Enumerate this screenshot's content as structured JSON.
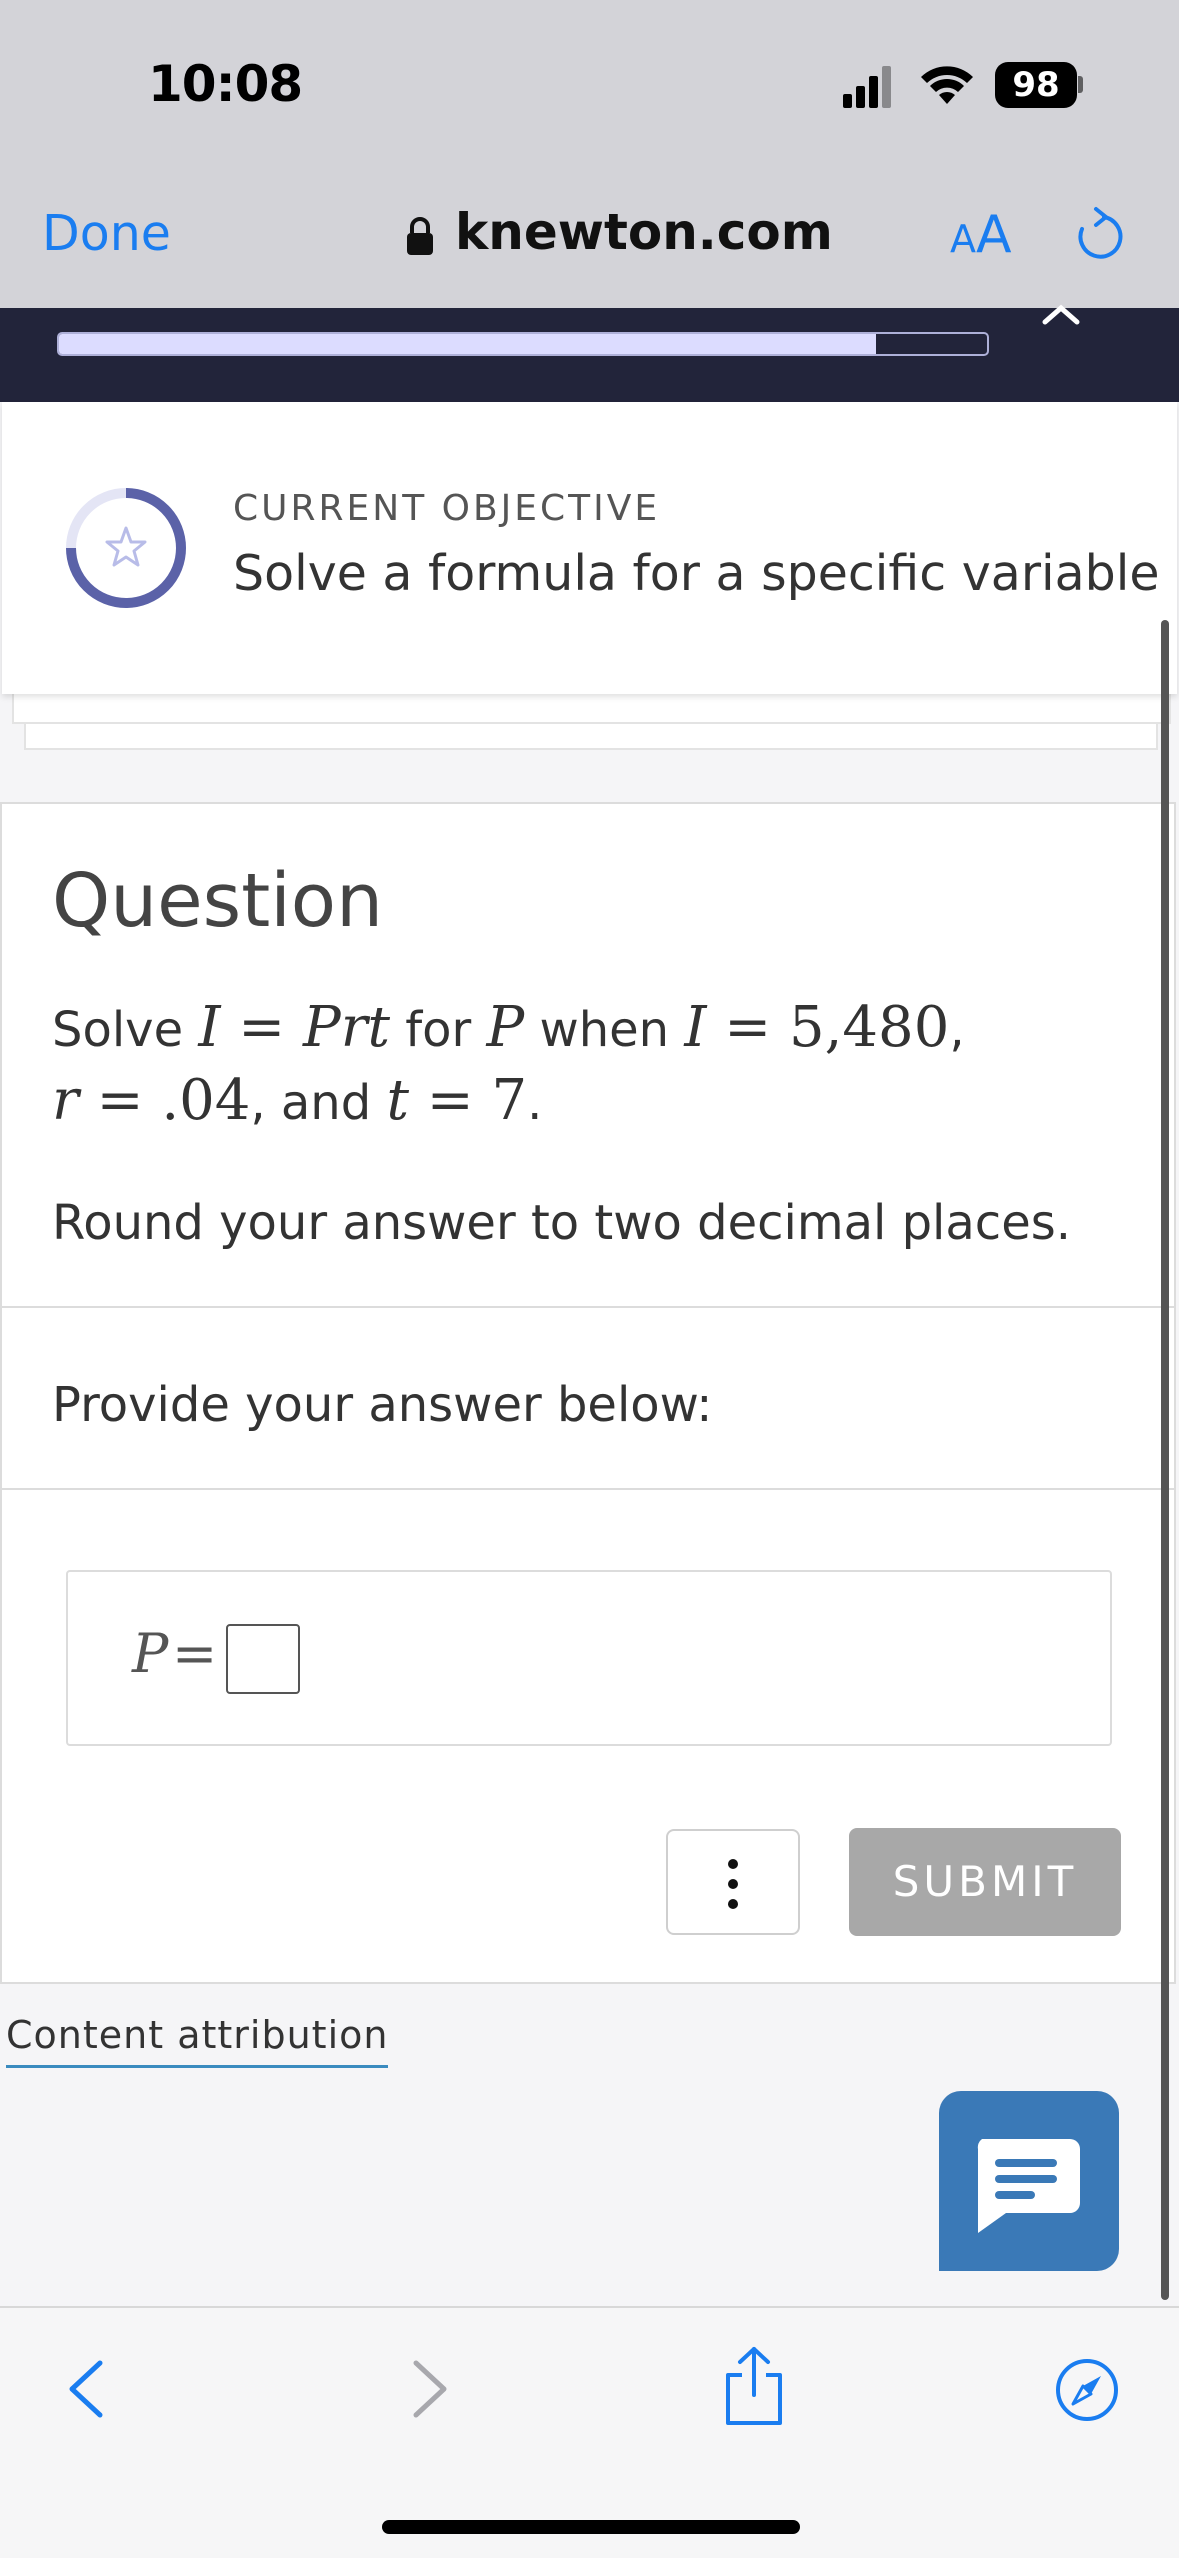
{
  "status_bar": {
    "time": "10:08",
    "battery": "98"
  },
  "browser": {
    "done_label": "Done",
    "url": "knewton.com",
    "text_size_small": "A",
    "text_size_large": "A"
  },
  "progress": {
    "fraction": 0.88
  },
  "objective": {
    "label": "CURRENT OBJECTIVE",
    "text": "Solve a formula for a specific variable"
  },
  "question": {
    "title": "Question",
    "line1": {
      "solve": "Solve ",
      "I1": "I",
      "eq1": " = ",
      "Prt": "Prt",
      "for": " for ",
      "P": "P",
      "when": " when ",
      "I2": "I",
      "eq2": " = ",
      "val_I": "5,480",
      "comma": ","
    },
    "line2": {
      "r": "r",
      "eq_r": " = ",
      "val_r": ".04",
      "and": ", and ",
      "t": "t",
      "eq_t": " = ",
      "val_t": "7",
      "period": "."
    },
    "round_instruction": "Round your answer to two decimal places."
  },
  "answer": {
    "prompt": "Provide your answer below:",
    "variable": "P",
    "equals": "=",
    "value": ""
  },
  "actions": {
    "submit_label": "SUBMIT"
  },
  "footer": {
    "attribution_label": "Content attribution"
  },
  "colors": {
    "accent": "#1a7df0",
    "header_dark": "#22243a",
    "chat": "#3a79b7",
    "submit_disabled": "#a8a8a8",
    "objective_ring": "#5b62a8"
  },
  "icons": [
    "lock-icon",
    "reload-icon",
    "collapse-chevron-icon",
    "star-icon",
    "more-options-icon",
    "chat-icon",
    "back-arrow-icon",
    "forward-arrow-icon",
    "share-icon",
    "compass-icon"
  ]
}
